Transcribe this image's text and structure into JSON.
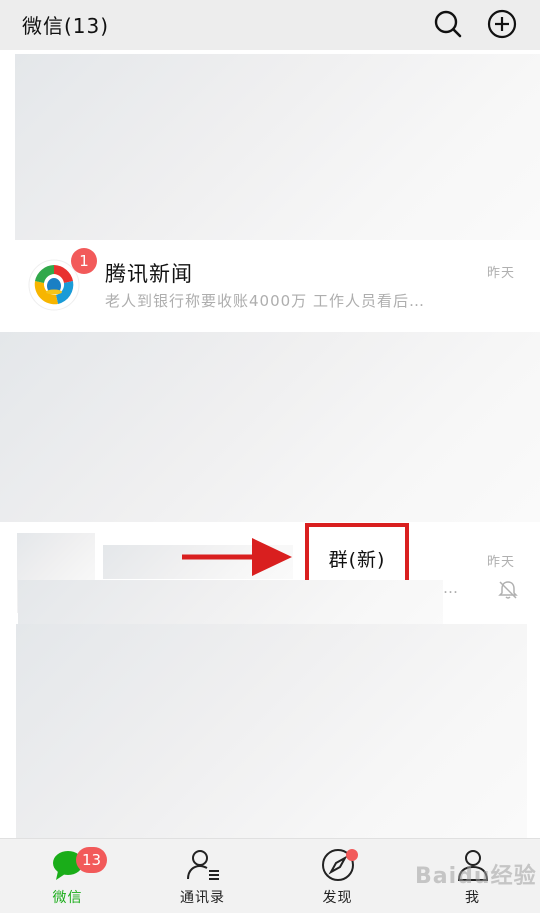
{
  "header": {
    "title": "微信(13)",
    "search_icon": "search-icon",
    "add_icon": "plus-circle-icon"
  },
  "chats": [
    {
      "name": "腾讯新闻",
      "unread": "1",
      "preview": "老人到银行称要收账4000万 工作人员看后…",
      "time": "昨天",
      "avatar_icon": "tencent-news-logo"
    },
    {
      "name": "",
      "preview": "…",
      "time": "昨天",
      "muted_icon": "bell-muted-icon"
    }
  ],
  "annotation": {
    "label": "群(新)",
    "color": "#d91f1f"
  },
  "tabbar": {
    "tabs": [
      {
        "label": "微信",
        "icon": "chat-bubble-icon",
        "badge": "13",
        "active": true
      },
      {
        "label": "通讯录",
        "icon": "contacts-icon"
      },
      {
        "label": "发现",
        "icon": "compass-icon",
        "dot": true
      },
      {
        "label": "我",
        "icon": "person-icon"
      }
    ]
  },
  "watermark": "Baidu经验",
  "colors": {
    "accent_green": "#1aad19",
    "badge_red": "#f25a5a",
    "topbar_bg": "#ededed"
  }
}
